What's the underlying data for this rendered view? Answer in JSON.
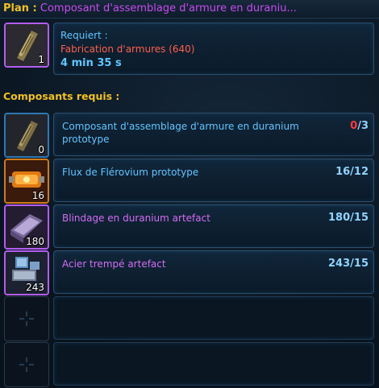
{
  "header": {
    "prefix": "Plan :",
    "title": "Composant d'assemblage d'armure en duraniu..."
  },
  "blueprint": {
    "quantity": "1",
    "requires_label": "Requiert :",
    "skill": "Fabrication d'armures (640)",
    "time": "4 min 35 s"
  },
  "components_label": "Composants requis :",
  "components": [
    {
      "name": "Composant d'assemblage d'armure en duranium prototype",
      "slot_qty": "0",
      "have": "0",
      "sep": "/",
      "need": "3",
      "have_color": "#ff3b3b",
      "name_color": "#5fc6ff",
      "icon": "armor-assembly-icon"
    },
    {
      "name": "Flux de Flérovium prototype",
      "slot_qty": "16",
      "have": "16",
      "sep": "/",
      "need": "12",
      "have_color": "#8fd4ff",
      "name_color": "#5fc6ff",
      "icon": "flux-canister-icon"
    },
    {
      "name": "Blindage en duranium artefact",
      "slot_qty": "180",
      "have": "180",
      "sep": "/",
      "need": "15",
      "have_color": "#8fd4ff",
      "name_color": "#d56cf4",
      "icon": "duranium-plating-icon"
    },
    {
      "name": "Acier trempé artefact",
      "slot_qty": "243",
      "have": "243",
      "sep": "/",
      "need": "15",
      "have_color": "#8fd4ff",
      "name_color": "#d56cf4",
      "icon": "tempered-steel-icon"
    }
  ],
  "empty_slots": [
    {
      "icon": "empty-slot-icon"
    },
    {
      "icon": "empty-slot-icon"
    }
  ]
}
